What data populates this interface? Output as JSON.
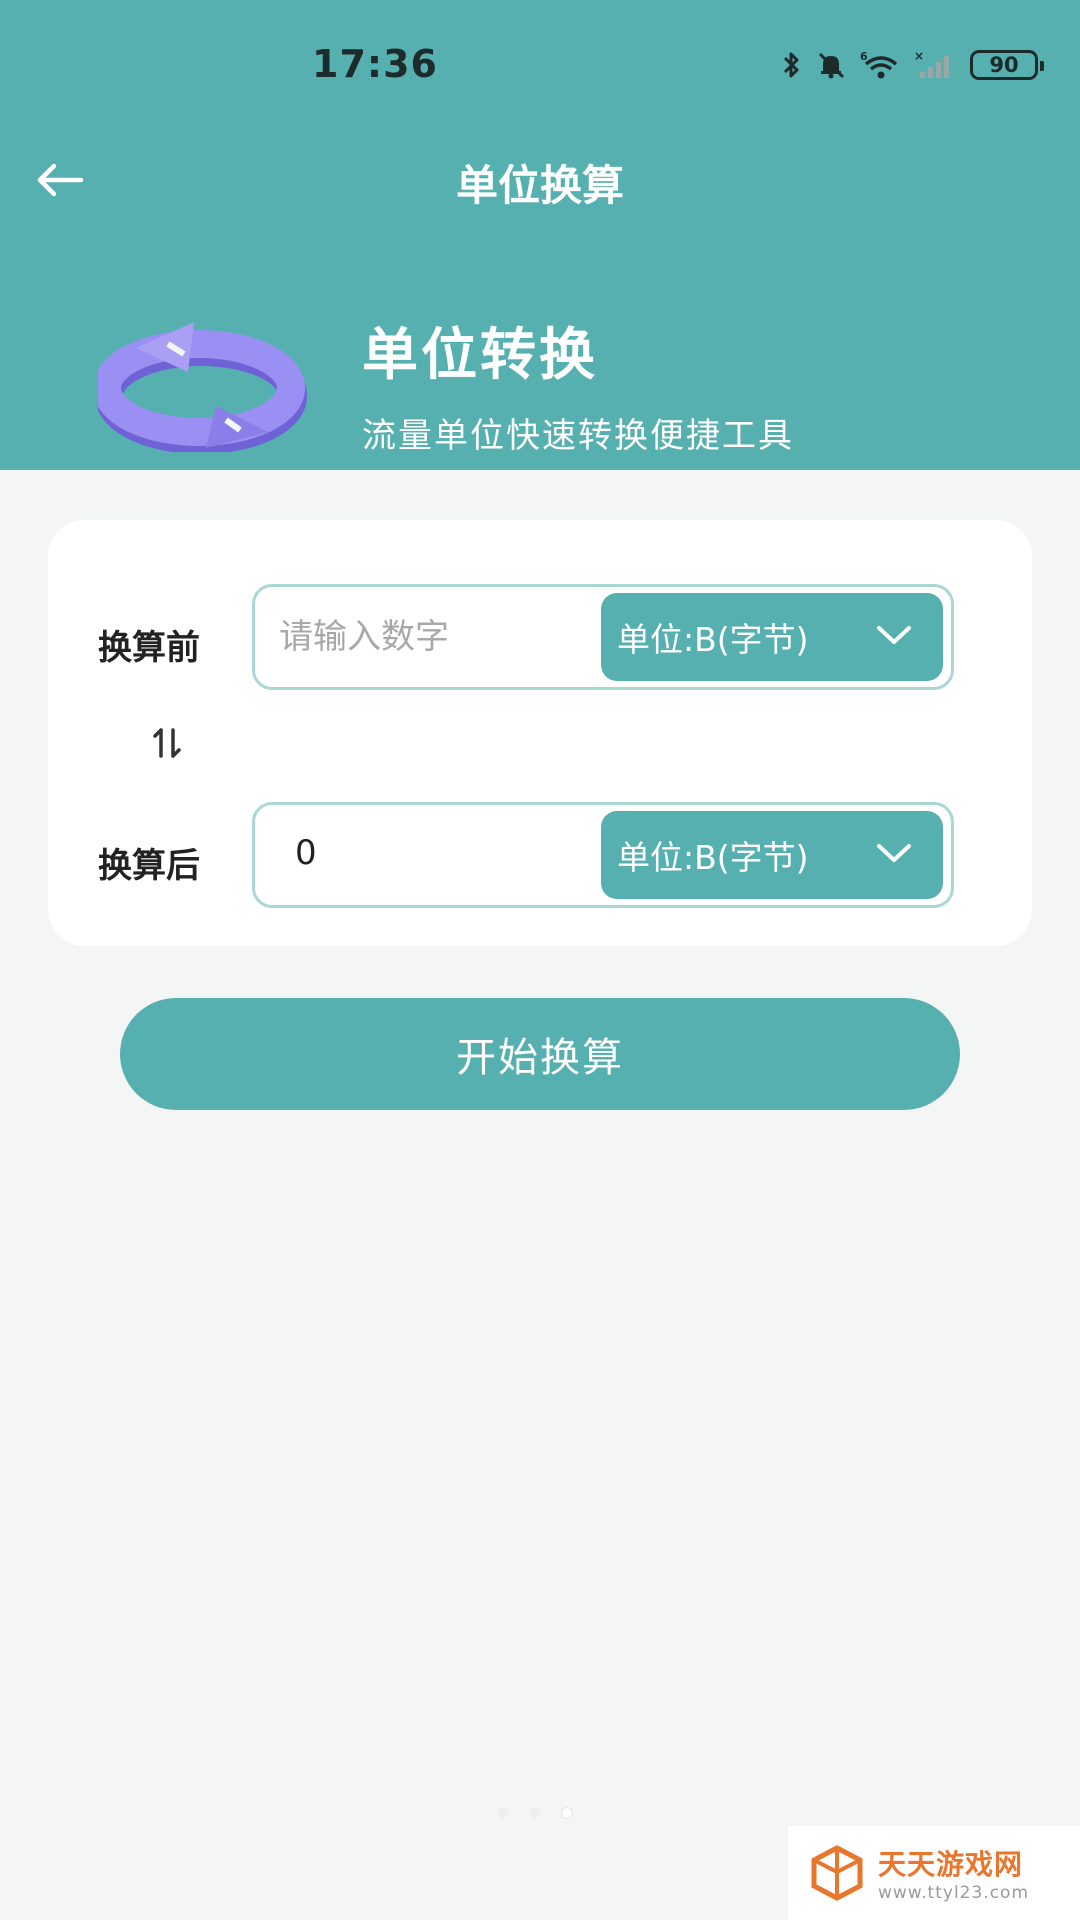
{
  "status_bar": {
    "time": "17:36",
    "battery": "90"
  },
  "nav": {
    "title": "单位换算"
  },
  "hero": {
    "title": "单位转换",
    "subtitle": "流量单位快速转换便捷工具"
  },
  "converter": {
    "before": {
      "label": "换算前",
      "placeholder": "请输入数字",
      "value": "",
      "unit": "单位:B(字节)"
    },
    "after": {
      "label": "换算后",
      "value": "0",
      "unit": "单位:B(字节)"
    }
  },
  "actions": {
    "start_label": "开始换算"
  },
  "watermark": {
    "name": "天天游戏网",
    "url": "www.ttyl23.com"
  },
  "colors": {
    "primary": "#57b0b0",
    "background": "#f4f5f5",
    "field_border": "#a9d7d6",
    "hero_icon": "#9a8ff2"
  },
  "icons": [
    "bluetooth-icon",
    "bell-off-icon",
    "wifi-icon",
    "cellular-signal-icon",
    "battery-icon",
    "back-arrow-icon",
    "refresh-cycle-icon",
    "swap-vertical-icon",
    "chevron-down-icon"
  ]
}
